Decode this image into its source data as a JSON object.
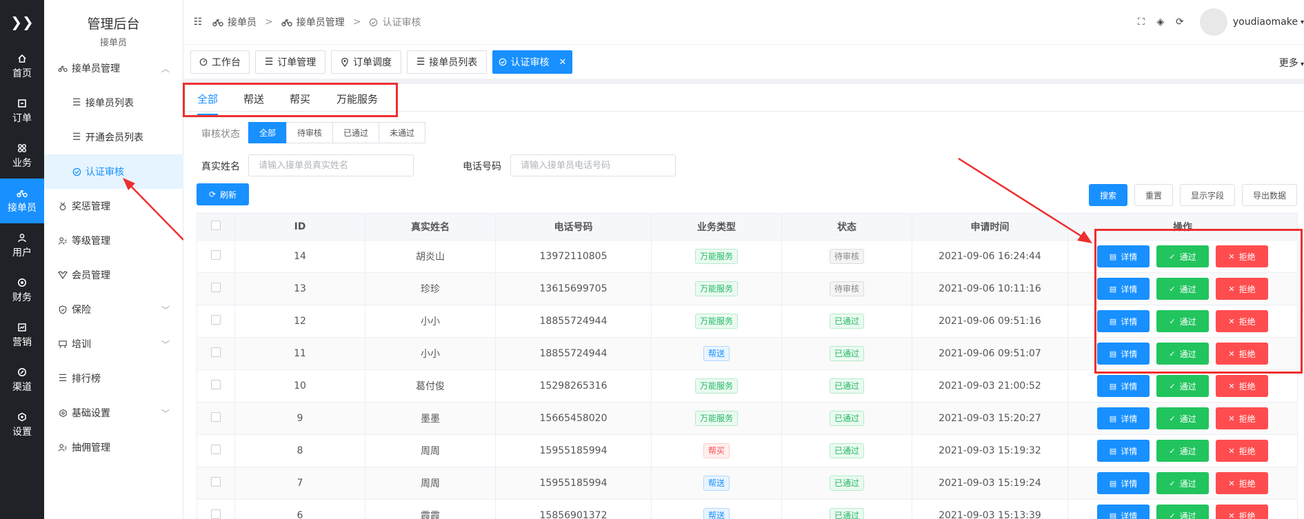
{
  "rail": {
    "logo": "❯❯",
    "items": [
      {
        "label": "首页",
        "icon": "home-icon"
      },
      {
        "label": "订单",
        "icon": "order-icon"
      },
      {
        "label": "业务",
        "icon": "business-icon"
      },
      {
        "label": "接单员",
        "icon": "bike-icon"
      },
      {
        "label": "用户",
        "icon": "user-icon"
      },
      {
        "label": "财务",
        "icon": "finance-icon"
      },
      {
        "label": "营销",
        "icon": "marketing-icon"
      },
      {
        "label": "渠道",
        "icon": "channel-icon"
      },
      {
        "label": "设置",
        "icon": "settings-icon"
      }
    ]
  },
  "sidebar": {
    "title": "管理后台",
    "subtitle": "接单员",
    "items": [
      {
        "label": "接单员管理",
        "icon": "bike-icon"
      },
      {
        "label": "接单员列表",
        "icon": "list-icon"
      },
      {
        "label": "开通会员列表",
        "icon": "list-icon"
      },
      {
        "label": "认证审核",
        "icon": "check-circle-icon"
      },
      {
        "label": "奖惩管理",
        "icon": "medal-icon"
      },
      {
        "label": "等级管理",
        "icon": "user-level-icon"
      },
      {
        "label": "会员管理",
        "icon": "vip-icon"
      },
      {
        "label": "保险",
        "icon": "shield-icon"
      },
      {
        "label": "培训",
        "icon": "training-icon"
      },
      {
        "label": "排行榜",
        "icon": "list-icon"
      },
      {
        "label": "基础设置",
        "icon": "gear-icon"
      },
      {
        "label": "抽佣管理",
        "icon": "user-commission-icon"
      }
    ]
  },
  "header": {
    "breadcrumb": [
      "接单员",
      "接单员管理",
      "认证审核"
    ],
    "username": "youdiaomake"
  },
  "tabs": {
    "items": [
      "工作台",
      "订单管理",
      "订单调度",
      "接单员列表",
      "认证审核"
    ],
    "more": "更多"
  },
  "biz_tabs": [
    "全部",
    "帮送",
    "帮买",
    "万能服务"
  ],
  "filters": {
    "status_label": "审核状态",
    "status_options": [
      "全部",
      "待审核",
      "已通过",
      "未通过"
    ],
    "name_label": "真实姓名",
    "name_placeholder": "请输入接单员真实姓名",
    "phone_label": "电话号码",
    "phone_placeholder": "请输入接单员电话号码"
  },
  "buttons": {
    "refresh": "刷新",
    "search": "搜索",
    "reset": "重置",
    "show_fields": "显示字段",
    "export": "导出数据"
  },
  "table": {
    "headers": [
      "ID",
      "真实姓名",
      "电话号码",
      "业务类型",
      "状态",
      "申请时间",
      "操作"
    ],
    "actions": {
      "detail": "详情",
      "pass": "通过",
      "reject": "拒绝"
    },
    "rows": [
      {
        "id": "14",
        "name": "胡炎山",
        "phone": "13972110805",
        "type": "万能服务",
        "type_color": "green",
        "status": "待审核",
        "status_color": "gray",
        "time": "2021-09-06 16:24:44"
      },
      {
        "id": "13",
        "name": "珍珍",
        "phone": "13615699705",
        "type": "万能服务",
        "type_color": "green",
        "status": "待审核",
        "status_color": "gray",
        "time": "2021-09-06 10:11:16"
      },
      {
        "id": "12",
        "name": "小小",
        "phone": "18855724944",
        "type": "万能服务",
        "type_color": "green",
        "status": "已通过",
        "status_color": "green",
        "time": "2021-09-06 09:51:16"
      },
      {
        "id": "11",
        "name": "小小",
        "phone": "18855724944",
        "type": "帮送",
        "type_color": "blue",
        "status": "已通过",
        "status_color": "green",
        "time": "2021-09-06 09:51:07"
      },
      {
        "id": "10",
        "name": "葛付俊",
        "phone": "15298265316",
        "type": "万能服务",
        "type_color": "green",
        "status": "已通过",
        "status_color": "green",
        "time": "2021-09-03 21:00:52"
      },
      {
        "id": "9",
        "name": "墨墨",
        "phone": "15665458020",
        "type": "万能服务",
        "type_color": "green",
        "status": "已通过",
        "status_color": "green",
        "time": "2021-09-03 15:20:27"
      },
      {
        "id": "8",
        "name": "周周",
        "phone": "15955185994",
        "type": "帮买",
        "type_color": "red",
        "status": "已通过",
        "status_color": "green",
        "time": "2021-09-03 15:19:32"
      },
      {
        "id": "7",
        "name": "周周",
        "phone": "15955185994",
        "type": "帮送",
        "type_color": "blue",
        "status": "已通过",
        "status_color": "green",
        "time": "2021-09-03 15:19:24"
      },
      {
        "id": "6",
        "name": "霞霞",
        "phone": "15856901372",
        "type": "帮送",
        "type_color": "blue",
        "status": "已通过",
        "status_color": "green",
        "time": "2021-09-03 15:13:39"
      }
    ]
  },
  "colors": {
    "accent": "#1890ff",
    "success": "#22c45e",
    "danger": "#ff4d4f",
    "rail_bg": "#1f2227",
    "highlight": "#ee2e2e"
  }
}
